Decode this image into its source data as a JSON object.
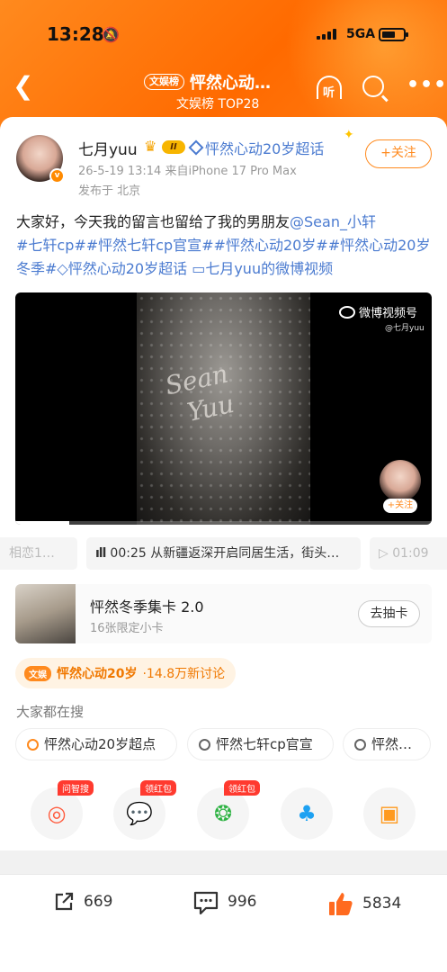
{
  "status": {
    "time": "13:28",
    "network": "5GA"
  },
  "nav": {
    "tag": "文娱榜",
    "title": "怦然心动…",
    "subtitle": "文娱榜 TOP28",
    "listen_label": "听"
  },
  "post": {
    "author": "七月yuu",
    "level": "II",
    "super_topic": "怦然心动20岁超话",
    "follow_label": "+关注",
    "meta_time_device": "26-5-19 13:14  来自iPhone 17 Pro Max",
    "meta_location": "发布于 北京",
    "text_plain": "大家好，今天我的留言也留给了我的男朋友",
    "mention": "@Sean_小轩",
    "tags_line": "#七轩cp##怦然七轩cp官宣##怦然心动20岁##怦然心动20岁冬季#",
    "super_topic_inline": "怦然心动20岁超话",
    "video_link": "七月yuu的微博视频"
  },
  "video": {
    "watermark": "微博视频号",
    "watermark_user": "@七月yuu",
    "mini_follow": "+关注",
    "scribble_1": "Sean",
    "scribble_2": "Yuu"
  },
  "chapters": [
    {
      "label": "相恋1…"
    },
    {
      "label": "00:25 从新疆返深开启同居生活，街头…"
    },
    {
      "label": "01:09"
    }
  ],
  "promo": {
    "title": "怦然冬季集卡 2.0",
    "subtitle": "16张限定小卡",
    "button": "去抽卡"
  },
  "hot_topic": {
    "badge": "文娱",
    "topic": "怦然心动20岁",
    "count": "·14.8万新讨论"
  },
  "search": {
    "heading": "大家都在搜",
    "suggestions": [
      "怦然心动20岁超点",
      "怦然七轩cp官宣",
      "怦然…"
    ]
  },
  "share": [
    {
      "name": "ask-search",
      "tag": "问智搜"
    },
    {
      "name": "wechat",
      "tag": "领红包"
    },
    {
      "name": "moments",
      "tag": "领红包"
    },
    {
      "name": "qq",
      "tag": ""
    },
    {
      "name": "save-image",
      "tag": ""
    }
  ],
  "footer": {
    "reposts": "669",
    "comments": "996",
    "likes": "5834"
  },
  "colors": {
    "brand": "#ff8a1e",
    "link": "#4b7bd0",
    "like": "#ff6a1f"
  }
}
